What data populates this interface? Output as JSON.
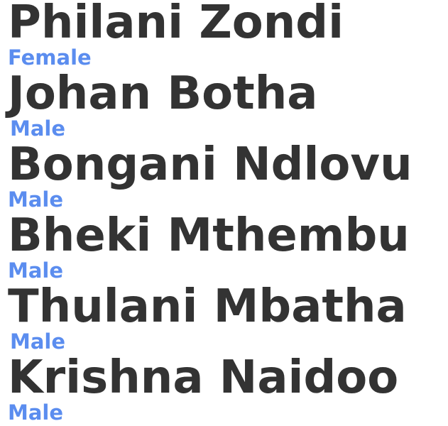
{
  "people": [
    {
      "name": "Philani Zondi",
      "gender": "Female"
    },
    {
      "name": "Johan Botha",
      "gender": "Male"
    },
    {
      "name": "Bongani Ndlovu",
      "gender": "Male"
    },
    {
      "name": "Bheki Mthembu",
      "gender": "Male"
    },
    {
      "name": "Thulani Mbatha",
      "gender": "Male"
    },
    {
      "name": "Krishna Naidoo",
      "gender": "Male"
    }
  ],
  "colors": {
    "name_text": "#333333",
    "gender_text": "#5b8def",
    "background": "#ffffff"
  }
}
